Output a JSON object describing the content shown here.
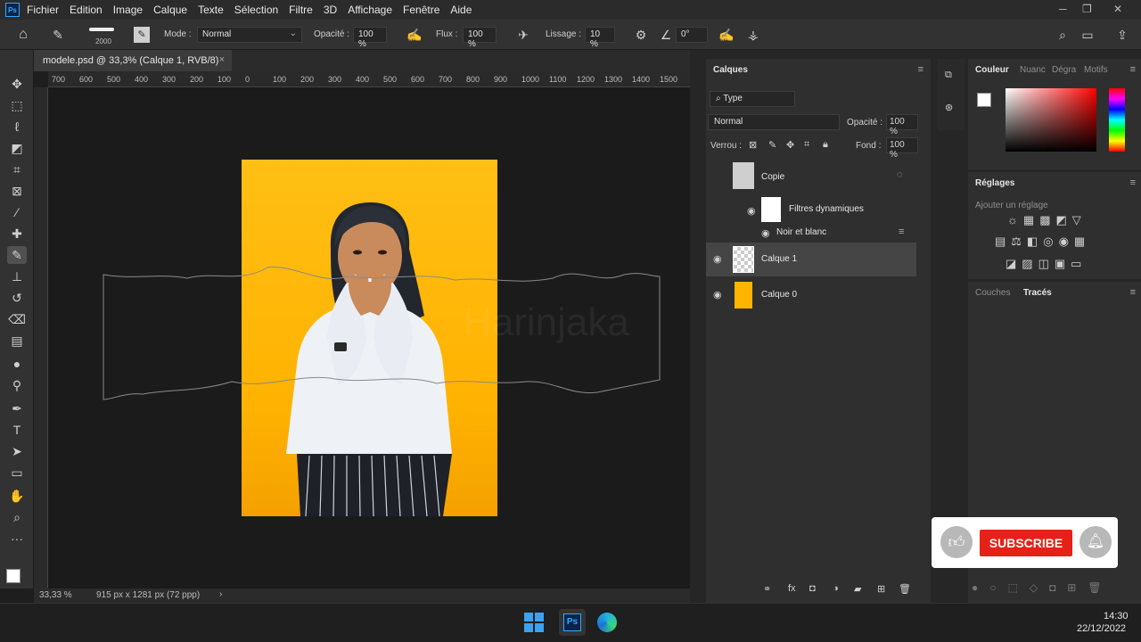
{
  "menu": {
    "logo": "Ps",
    "items": [
      "Fichier",
      "Edition",
      "Image",
      "Calque",
      "Texte",
      "Sélection",
      "Filtre",
      "3D",
      "Affichage",
      "Fenêtre",
      "Aide"
    ]
  },
  "options_bar": {
    "brush_size": "2000",
    "mode_label": "Mode :",
    "mode_value": "Normal",
    "opacity_label": "Opacité :",
    "opacity_value": "100 %",
    "flux_label": "Flux :",
    "flux_value": "100 %",
    "smoothing_label": "Lissage :",
    "smoothing_value": "10 %",
    "angle_value": "0°"
  },
  "document": {
    "tab_title": "modele.psd @ 33,3% (Calque 1, RVB/8)",
    "ruler_labels": [
      "700",
      "600",
      "500",
      "400",
      "300",
      "200",
      "100",
      "0",
      "100",
      "200",
      "300",
      "400",
      "500",
      "600",
      "700",
      "800",
      "900",
      "1000",
      "1100",
      "1200",
      "1300",
      "1400",
      "1500"
    ],
    "watermark": "Harinjaka",
    "zoom": "33,33 %",
    "dimensions": "915 px x 1281 px (72 ppp)"
  },
  "layers_panel": {
    "title": "Calques",
    "filter_value": "Type",
    "blend_mode": "Normal",
    "opacity_label": "Opacité :",
    "opacity_value": "100 %",
    "lock_label": "Verrou :",
    "fill_label": "Fond :",
    "fill_value": "100 %",
    "layers": [
      {
        "name": "Copie",
        "visible": false
      },
      {
        "name": "Filtres dynamiques",
        "visible": true
      },
      {
        "name": "Noir et blanc",
        "visible": true
      },
      {
        "name": "Calque 1",
        "visible": true
      },
      {
        "name": "Calque 0",
        "visible": true
      }
    ]
  },
  "color_panel": {
    "tabs": [
      "Couleur",
      "Nuanc",
      "Dégra",
      "Motifs"
    ]
  },
  "adjustments_panel": {
    "title": "Réglages",
    "subtitle": "Ajouter un réglage"
  },
  "bottom_panel": {
    "tabs": [
      "Couches",
      "Tracés"
    ]
  },
  "overlay": {
    "subscribe_label": "SUBSCRIBE"
  },
  "taskbar": {
    "time": "14:30",
    "date": "22/12/2022"
  },
  "colors": {
    "accent": "#31a8ff",
    "photo_bg": "#ffb400",
    "subscribe_red": "#e62117"
  }
}
